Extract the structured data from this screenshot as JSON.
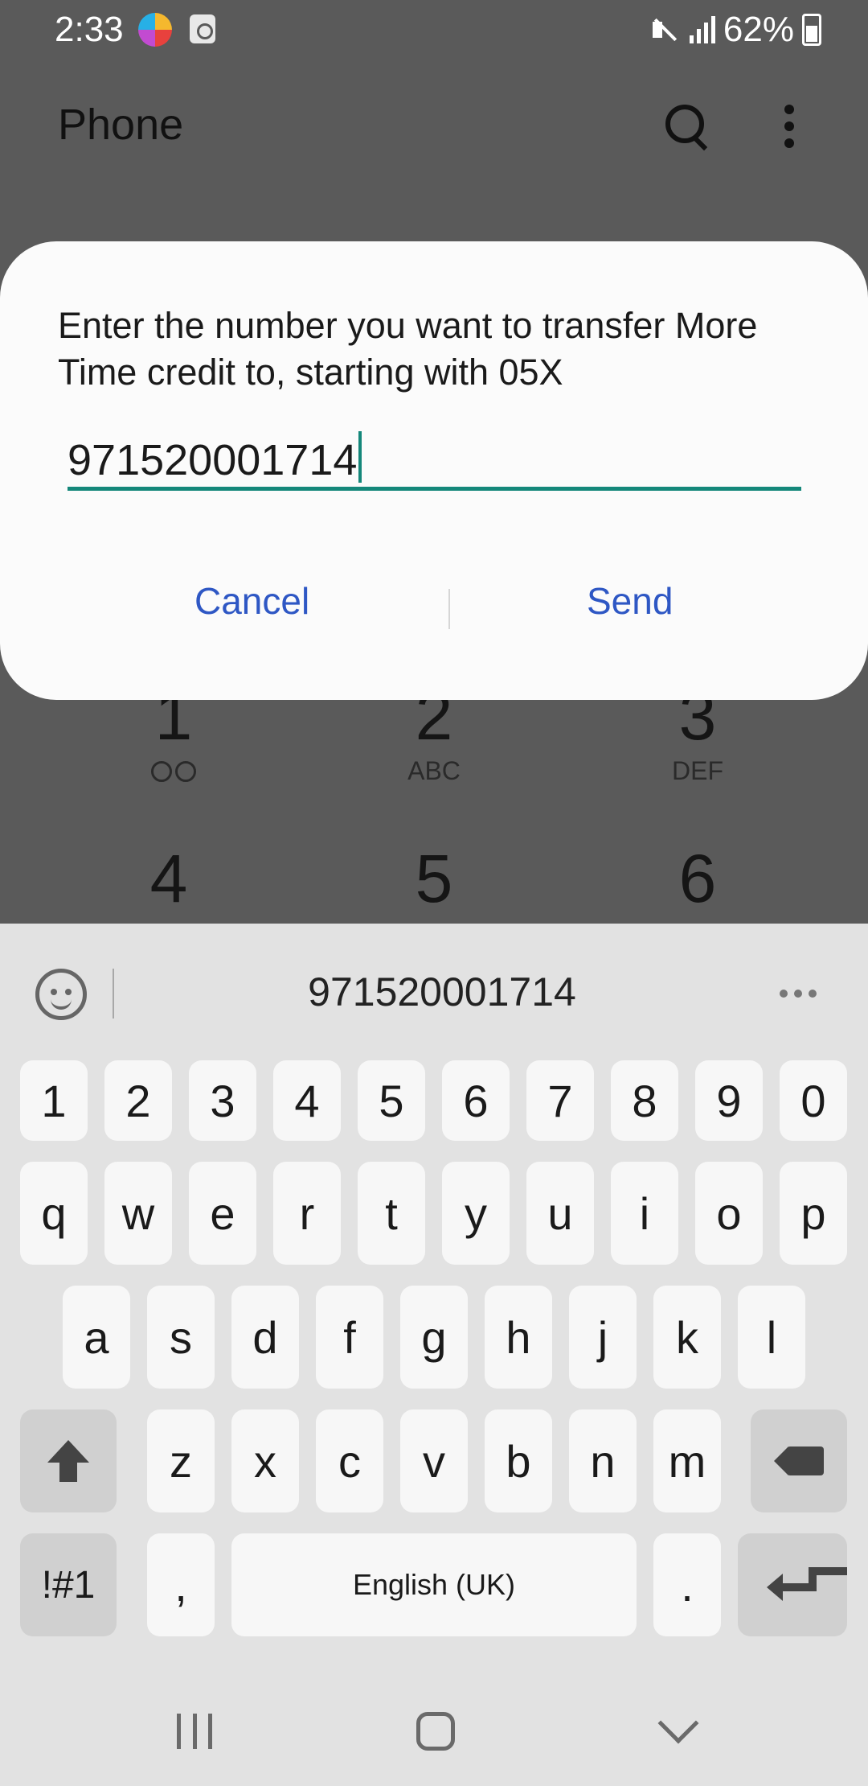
{
  "status_bar": {
    "time": "2:33",
    "battery": "62%"
  },
  "app_bar": {
    "title": "Phone"
  },
  "dialog": {
    "message": "Enter the number you want to transfer More Time credit to, starting with 05X",
    "input_value": "971520001714",
    "cancel_label": "Cancel",
    "send_label": "Send"
  },
  "dialpad": [
    {
      "num": "1",
      "sub": ""
    },
    {
      "num": "2",
      "sub": "ABC"
    },
    {
      "num": "3",
      "sub": "DEF"
    },
    {
      "num": "4",
      "sub": ""
    },
    {
      "num": "5",
      "sub": ""
    },
    {
      "num": "6",
      "sub": ""
    }
  ],
  "keyboard": {
    "suggestion": "971520001714",
    "row_numbers": [
      "1",
      "2",
      "3",
      "4",
      "5",
      "6",
      "7",
      "8",
      "9",
      "0"
    ],
    "row_top": [
      "q",
      "w",
      "e",
      "r",
      "t",
      "y",
      "u",
      "i",
      "o",
      "p"
    ],
    "row_middle": [
      "a",
      "s",
      "d",
      "f",
      "g",
      "h",
      "j",
      "k",
      "l"
    ],
    "row_bottom": [
      "z",
      "x",
      "c",
      "v",
      "b",
      "n",
      "m"
    ],
    "symbols_label": "!#1",
    "comma_label": ",",
    "space_label": "English (UK)",
    "period_label": "."
  }
}
